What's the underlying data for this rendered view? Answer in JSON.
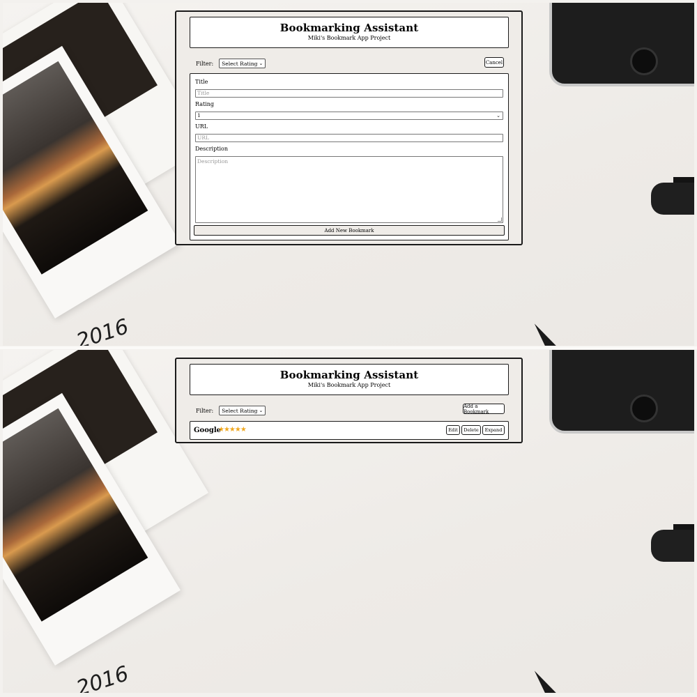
{
  "app": {
    "title": "Bookmarking Assistant",
    "subtitle": "Miki's Bookmark App Project"
  },
  "filter": {
    "label": "Filter:",
    "selected": "Select Rating"
  },
  "add_view": {
    "cancel_label": "Cancel",
    "form": {
      "title_label": "Title",
      "title_placeholder": "Title",
      "rating_label": "Rating",
      "rating_value": "1",
      "url_label": "URL",
      "url_placeholder": "URL",
      "description_label": "Description",
      "description_placeholder": "Description",
      "submit_label": "Add New Bookmark"
    }
  },
  "list_view": {
    "add_label": "Add a Bookmark",
    "bookmarks": [
      {
        "title": "Google",
        "rating": 5,
        "stars": "★★★★★",
        "edit_label": "Edit",
        "delete_label": "Delete",
        "expand_label": "Expand"
      }
    ]
  },
  "background": {
    "photo_caption": "2016"
  },
  "colors": {
    "star": "#f0a820",
    "card_bg": "#efece8",
    "border": "#1a1a1a"
  }
}
